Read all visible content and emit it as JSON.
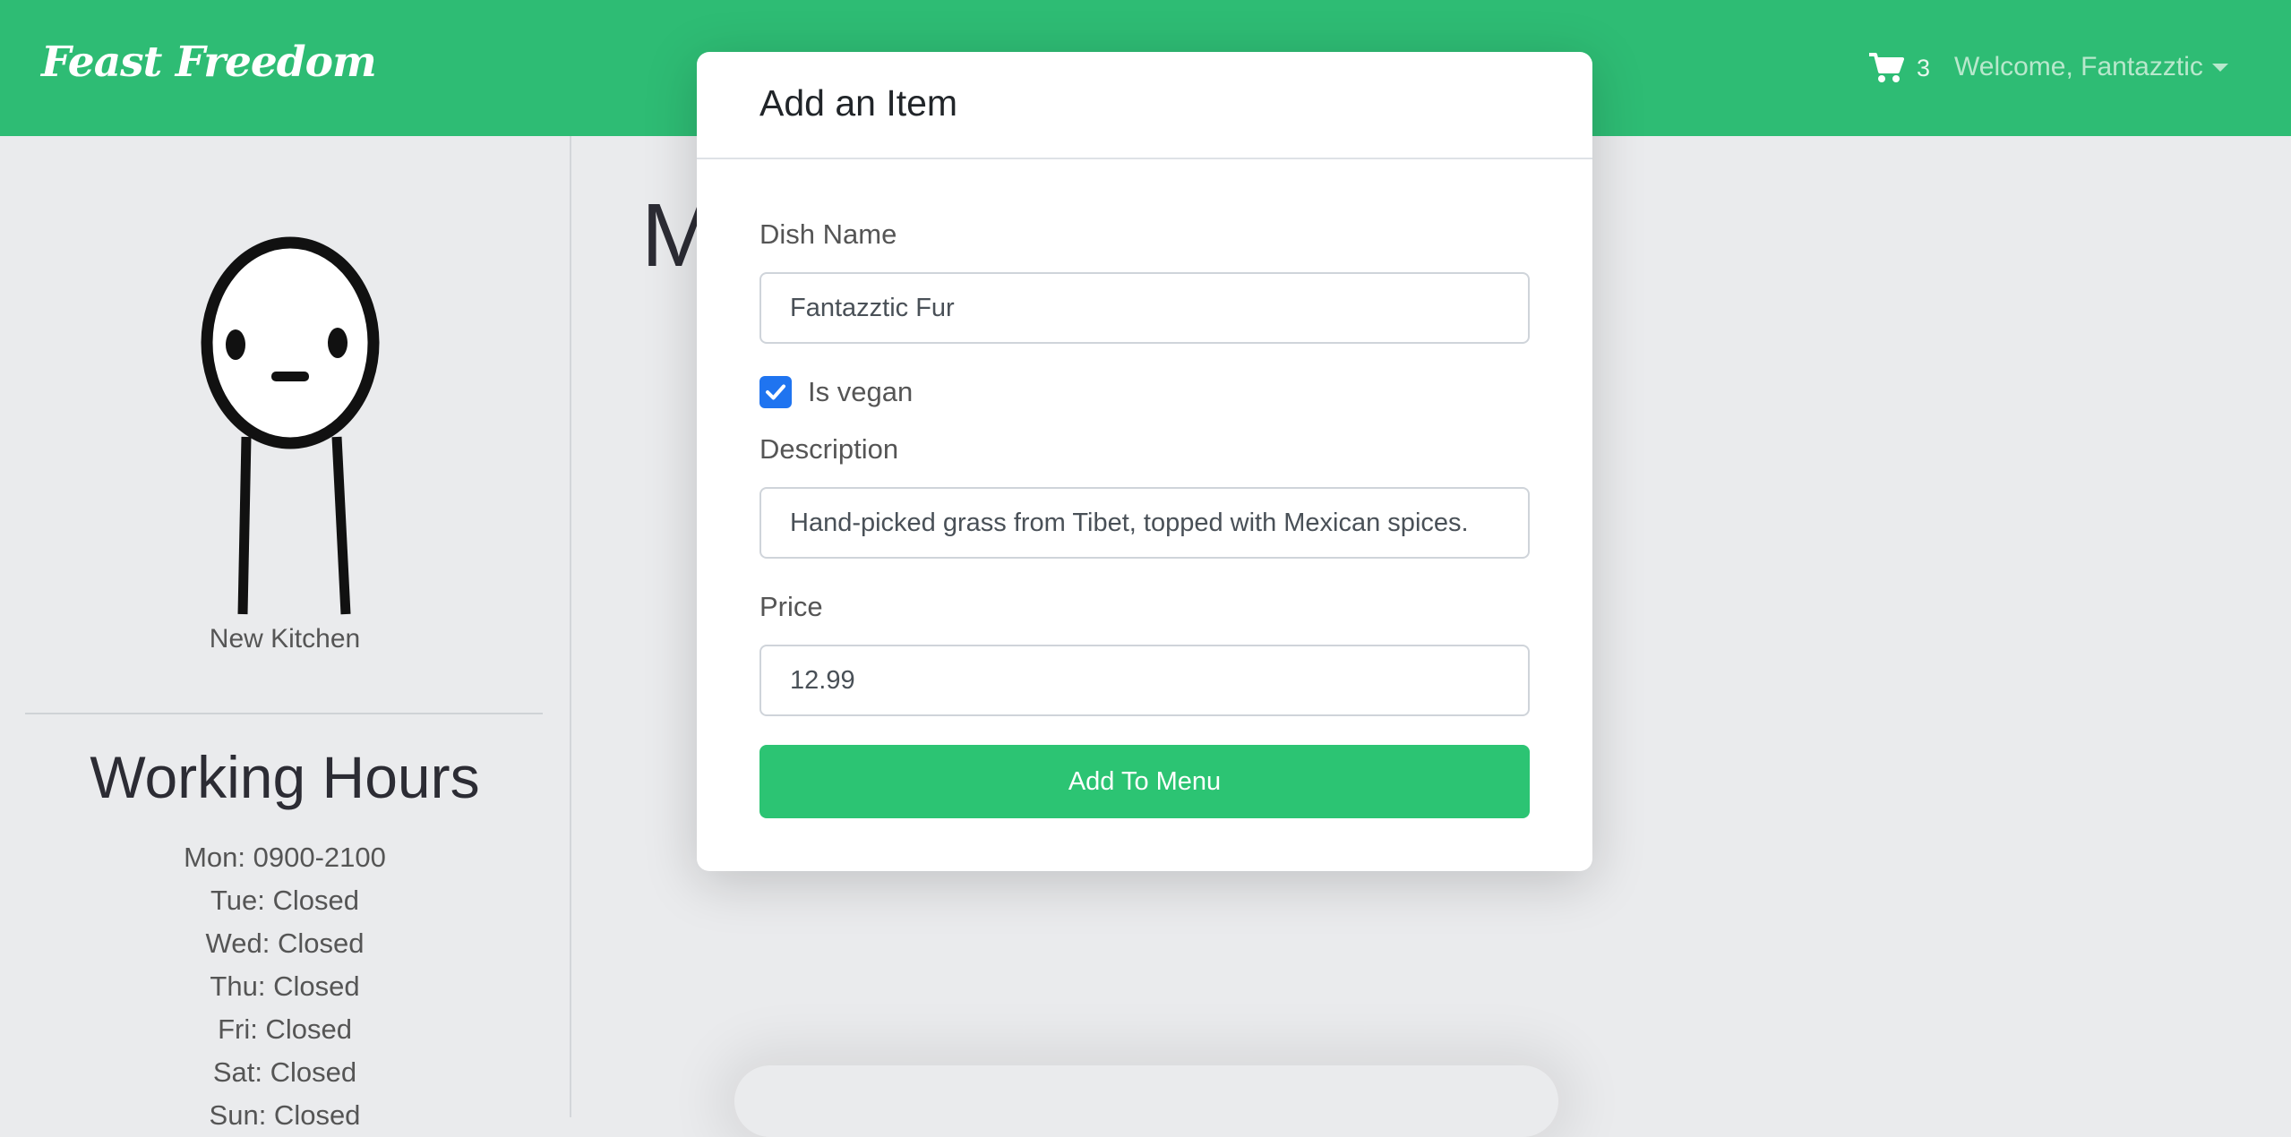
{
  "navbar": {
    "brand": "Feast Freedom",
    "cart_count": "3",
    "welcome": "Welcome, Fantazztic"
  },
  "sidebar": {
    "kitchen_name": "New Kitchen",
    "hours_title": "Working Hours",
    "hours": [
      "Mon: 0900-2100",
      "Tue: Closed",
      "Wed: Closed",
      "Thu: Closed",
      "Fri: Closed",
      "Sat: Closed",
      "Sun: Closed"
    ]
  },
  "main": {
    "heading_visible": "M"
  },
  "modal": {
    "title": "Add an Item",
    "dish_name_label": "Dish Name",
    "dish_name_value": "Fantazztic Fur",
    "vegan_label": "Is vegan",
    "vegan_checked": true,
    "description_label": "Description",
    "description_value": "Hand-picked grass from Tibet, topped with Mexican spices.",
    "price_label": "Price",
    "price_value": "12.99",
    "submit_label": "Add To Menu"
  },
  "colors": {
    "navbar": "#2ebc74",
    "submit_button": "#2cc473",
    "checkbox": "#1f74f0",
    "page_background": "#eaebed"
  },
  "icons": [
    "cart-icon",
    "caret-down-icon",
    "checkmark-icon"
  ]
}
